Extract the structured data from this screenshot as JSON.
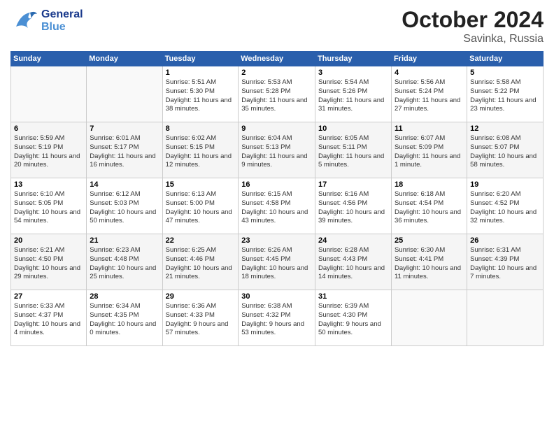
{
  "header": {
    "logo_general": "General",
    "logo_blue": "Blue",
    "month": "October 2024",
    "location": "Savinka, Russia"
  },
  "days_of_week": [
    "Sunday",
    "Monday",
    "Tuesday",
    "Wednesday",
    "Thursday",
    "Friday",
    "Saturday"
  ],
  "weeks": [
    [
      {
        "day": "",
        "info": ""
      },
      {
        "day": "",
        "info": ""
      },
      {
        "day": "1",
        "info": "Sunrise: 5:51 AM\nSunset: 5:30 PM\nDaylight: 11 hours and 38 minutes."
      },
      {
        "day": "2",
        "info": "Sunrise: 5:53 AM\nSunset: 5:28 PM\nDaylight: 11 hours and 35 minutes."
      },
      {
        "day": "3",
        "info": "Sunrise: 5:54 AM\nSunset: 5:26 PM\nDaylight: 11 hours and 31 minutes."
      },
      {
        "day": "4",
        "info": "Sunrise: 5:56 AM\nSunset: 5:24 PM\nDaylight: 11 hours and 27 minutes."
      },
      {
        "day": "5",
        "info": "Sunrise: 5:58 AM\nSunset: 5:22 PM\nDaylight: 11 hours and 23 minutes."
      }
    ],
    [
      {
        "day": "6",
        "info": "Sunrise: 5:59 AM\nSunset: 5:19 PM\nDaylight: 11 hours and 20 minutes."
      },
      {
        "day": "7",
        "info": "Sunrise: 6:01 AM\nSunset: 5:17 PM\nDaylight: 11 hours and 16 minutes."
      },
      {
        "day": "8",
        "info": "Sunrise: 6:02 AM\nSunset: 5:15 PM\nDaylight: 11 hours and 12 minutes."
      },
      {
        "day": "9",
        "info": "Sunrise: 6:04 AM\nSunset: 5:13 PM\nDaylight: 11 hours and 9 minutes."
      },
      {
        "day": "10",
        "info": "Sunrise: 6:05 AM\nSunset: 5:11 PM\nDaylight: 11 hours and 5 minutes."
      },
      {
        "day": "11",
        "info": "Sunrise: 6:07 AM\nSunset: 5:09 PM\nDaylight: 11 hours and 1 minute."
      },
      {
        "day": "12",
        "info": "Sunrise: 6:08 AM\nSunset: 5:07 PM\nDaylight: 10 hours and 58 minutes."
      }
    ],
    [
      {
        "day": "13",
        "info": "Sunrise: 6:10 AM\nSunset: 5:05 PM\nDaylight: 10 hours and 54 minutes."
      },
      {
        "day": "14",
        "info": "Sunrise: 6:12 AM\nSunset: 5:03 PM\nDaylight: 10 hours and 50 minutes."
      },
      {
        "day": "15",
        "info": "Sunrise: 6:13 AM\nSunset: 5:00 PM\nDaylight: 10 hours and 47 minutes."
      },
      {
        "day": "16",
        "info": "Sunrise: 6:15 AM\nSunset: 4:58 PM\nDaylight: 10 hours and 43 minutes."
      },
      {
        "day": "17",
        "info": "Sunrise: 6:16 AM\nSunset: 4:56 PM\nDaylight: 10 hours and 39 minutes."
      },
      {
        "day": "18",
        "info": "Sunrise: 6:18 AM\nSunset: 4:54 PM\nDaylight: 10 hours and 36 minutes."
      },
      {
        "day": "19",
        "info": "Sunrise: 6:20 AM\nSunset: 4:52 PM\nDaylight: 10 hours and 32 minutes."
      }
    ],
    [
      {
        "day": "20",
        "info": "Sunrise: 6:21 AM\nSunset: 4:50 PM\nDaylight: 10 hours and 29 minutes."
      },
      {
        "day": "21",
        "info": "Sunrise: 6:23 AM\nSunset: 4:48 PM\nDaylight: 10 hours and 25 minutes."
      },
      {
        "day": "22",
        "info": "Sunrise: 6:25 AM\nSunset: 4:46 PM\nDaylight: 10 hours and 21 minutes."
      },
      {
        "day": "23",
        "info": "Sunrise: 6:26 AM\nSunset: 4:45 PM\nDaylight: 10 hours and 18 minutes."
      },
      {
        "day": "24",
        "info": "Sunrise: 6:28 AM\nSunset: 4:43 PM\nDaylight: 10 hours and 14 minutes."
      },
      {
        "day": "25",
        "info": "Sunrise: 6:30 AM\nSunset: 4:41 PM\nDaylight: 10 hours and 11 minutes."
      },
      {
        "day": "26",
        "info": "Sunrise: 6:31 AM\nSunset: 4:39 PM\nDaylight: 10 hours and 7 minutes."
      }
    ],
    [
      {
        "day": "27",
        "info": "Sunrise: 6:33 AM\nSunset: 4:37 PM\nDaylight: 10 hours and 4 minutes."
      },
      {
        "day": "28",
        "info": "Sunrise: 6:34 AM\nSunset: 4:35 PM\nDaylight: 10 hours and 0 minutes."
      },
      {
        "day": "29",
        "info": "Sunrise: 6:36 AM\nSunset: 4:33 PM\nDaylight: 9 hours and 57 minutes."
      },
      {
        "day": "30",
        "info": "Sunrise: 6:38 AM\nSunset: 4:32 PM\nDaylight: 9 hours and 53 minutes."
      },
      {
        "day": "31",
        "info": "Sunrise: 6:39 AM\nSunset: 4:30 PM\nDaylight: 9 hours and 50 minutes."
      },
      {
        "day": "",
        "info": ""
      },
      {
        "day": "",
        "info": ""
      }
    ]
  ]
}
